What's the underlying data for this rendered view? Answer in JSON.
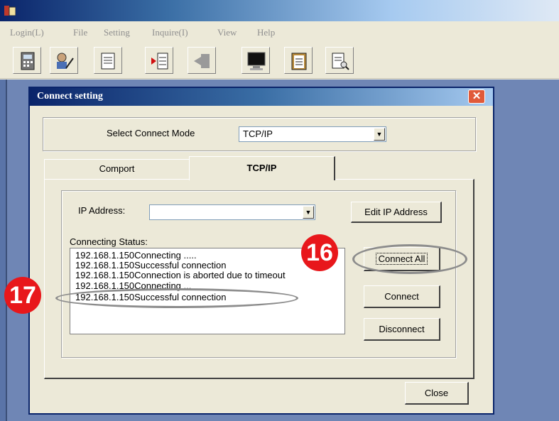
{
  "menu": {
    "items": [
      "Login(L)",
      "File",
      "Setting",
      "Inquire(I)",
      "View",
      "Help"
    ]
  },
  "toolbar": {
    "icons": [
      "calculator-icon",
      "user-edit-icon",
      "document-icon",
      "play-list-icon",
      "back-disabled-icon",
      "monitor-icon",
      "clipboard-icon",
      "search-document-icon"
    ]
  },
  "dialog": {
    "title": "Connect setting",
    "mode_label": "Select Connect Mode",
    "mode_value": "TCP/IP",
    "tabs": [
      "Comport",
      "TCP/IP"
    ],
    "active_tab": "TCP/IP",
    "ip_label": "IP Address:",
    "ip_value": "",
    "edit_ip_label": "Edit IP Address",
    "status_label": "Connecting Status:",
    "status_lines": [
      "192.168.1.150Connecting .....",
      "192.168.1.150Successful connection",
      "192.168.1.150Connection is aborted due to timeout",
      "192.168.1.150Connecting ...",
      "192.168.1.150Successful connection"
    ],
    "connect_all_label": "Connect All",
    "connect_label": "Connect",
    "disconnect_label": "Disconnect",
    "close_label": "Close"
  },
  "annotations": {
    "badge_16": "16",
    "badge_17": "17",
    "badge_color": "#e8171b"
  }
}
